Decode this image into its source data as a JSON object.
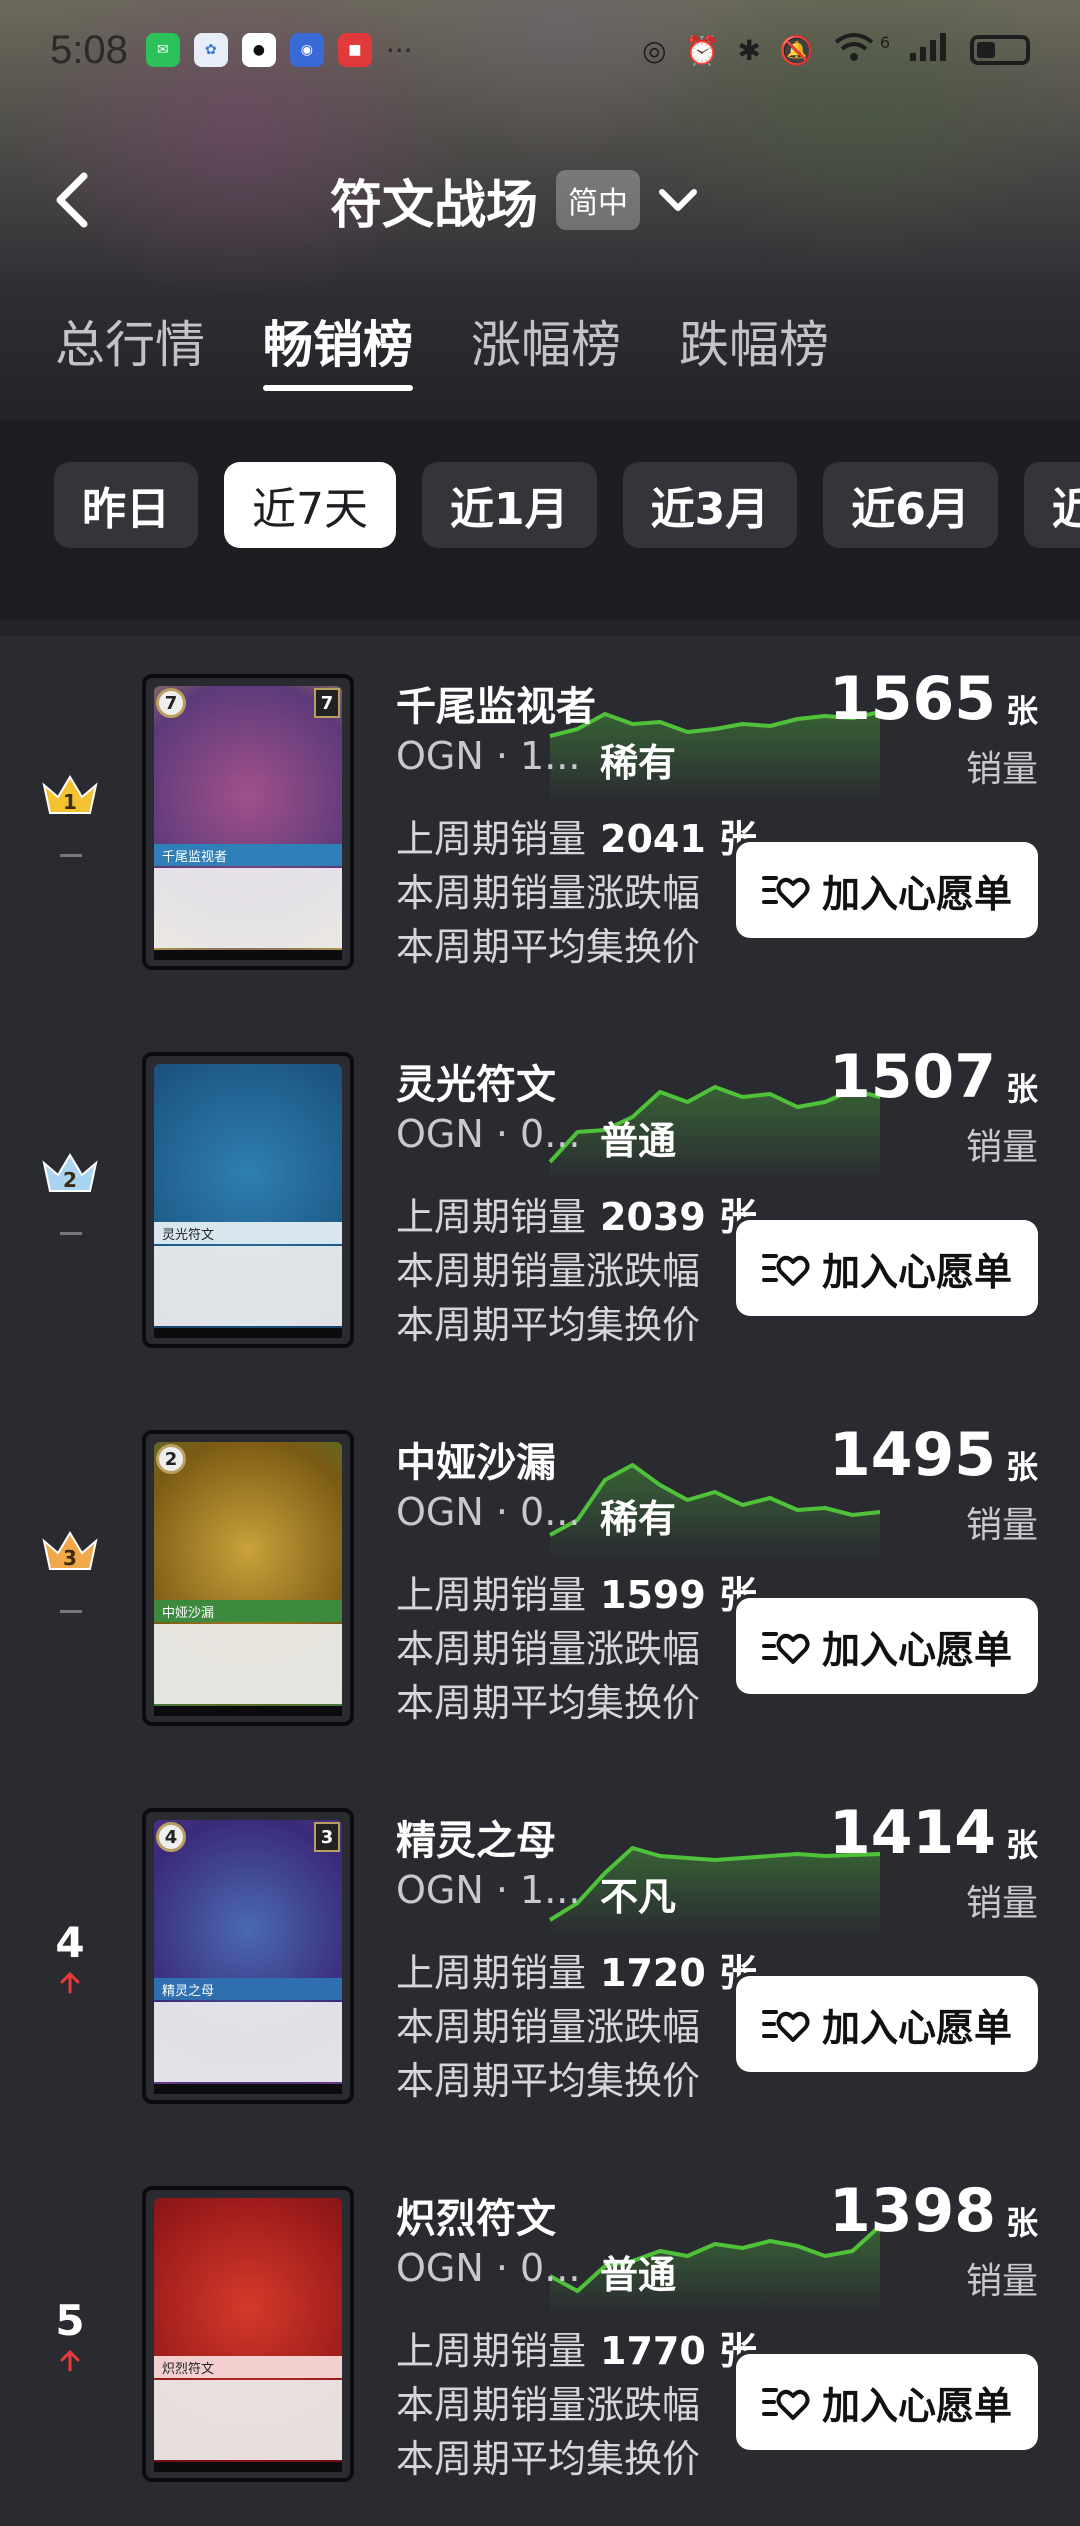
{
  "status_bar": {
    "time": "5:08",
    "signal_label": "6"
  },
  "nav": {
    "title": "符文战场",
    "lang_badge": "简中"
  },
  "tabs": [
    {
      "label": "总行情",
      "active": false
    },
    {
      "label": "畅销榜",
      "active": true
    },
    {
      "label": "涨幅榜",
      "active": false
    },
    {
      "label": "跌幅榜",
      "active": false
    }
  ],
  "periods": [
    {
      "label": "昨日",
      "active": false
    },
    {
      "label": "近7天",
      "active": true
    },
    {
      "label": "近1月",
      "active": false
    },
    {
      "label": "近3月",
      "active": false
    },
    {
      "label": "近6月",
      "active": false
    },
    {
      "label": "近",
      "active": false
    }
  ],
  "labels": {
    "sales_unit": "张",
    "sales_label": "销量",
    "prev_label": "上周期销量",
    "change_label": "本周期销量涨跌幅",
    "avg_label": "本周期平均集换价",
    "wish_button": "加入心愿单"
  },
  "cards": [
    {
      "rank": "1",
      "rank_color": "#f2c230",
      "name": "千尾监视者",
      "code": "OGN · 1...",
      "rarity": "稀有",
      "sales": "1565",
      "prev_sales": "2041 张",
      "thumb_cost": "7",
      "thumb_power": "7",
      "thumb_name": "千尾监视者",
      "art_colors": [
        "#5c3a7a",
        "#a0508a",
        "#b8a040"
      ],
      "band_color": "#2f7fb8",
      "trend": [
        0.42,
        0.35,
        0.2,
        0.3,
        0.28,
        0.38,
        0.35,
        0.3,
        0.32,
        0.25,
        0.22,
        0.24,
        0.18
      ]
    },
    {
      "rank": "2",
      "rank_color": "#a9d4f2",
      "name": "灵光符文",
      "code": "OGN · 0...",
      "rarity": "普通",
      "sales": "1507",
      "prev_sales": "2039 张",
      "thumb_cost": "",
      "thumb_power": "",
      "thumb_name": "灵光符文",
      "art_colors": [
        "#1e5a88",
        "#2e7fb0",
        "#163f66"
      ],
      "band_color": "#d8e6ee",
      "trend": [
        0.9,
        0.6,
        0.58,
        0.45,
        0.2,
        0.3,
        0.15,
        0.25,
        0.22,
        0.35,
        0.3,
        0.18,
        0.25
      ]
    },
    {
      "rank": "3",
      "rank_color": "#f0a84a",
      "name": "中娅沙漏",
      "code": "OGN · 0...",
      "rarity": "稀有",
      "sales": "1495",
      "prev_sales": "1599 张",
      "thumb_cost": "2",
      "thumb_power": "",
      "thumb_name": "中娅沙漏",
      "art_colors": [
        "#7a5a14",
        "#c9a23a",
        "#3d7a3a"
      ],
      "band_color": "#3b8a3e",
      "trend": [
        0.85,
        0.7,
        0.3,
        0.15,
        0.35,
        0.5,
        0.42,
        0.55,
        0.48,
        0.6,
        0.58,
        0.65,
        0.62
      ]
    },
    {
      "rank": "4",
      "rank_color": "#ffffff",
      "name": "精灵之母",
      "code": "OGN · 1...",
      "rarity": "不凡",
      "sales": "1414",
      "prev_sales": "1720 张",
      "thumb_cost": "4",
      "thumb_power": "3",
      "thumb_name": "精灵之母",
      "art_colors": [
        "#3a2a7a",
        "#4a6ab0",
        "#6a3a8a"
      ],
      "band_color": "#2f6fb0",
      "trend": [
        0.92,
        0.75,
        0.45,
        0.2,
        0.28,
        0.3,
        0.32,
        0.3,
        0.28,
        0.26,
        0.28,
        0.27,
        0.26
      ]
    },
    {
      "rank": "5",
      "rank_color": "#ffffff",
      "name": "炽烈符文",
      "code": "OGN · 0...",
      "rarity": "普通",
      "sales": "1398",
      "prev_sales": "1770 张",
      "thumb_cost": "",
      "thumb_power": "",
      "thumb_name": "炽烈符文",
      "art_colors": [
        "#9a1a1a",
        "#d43a2a",
        "#6a0e12"
      ],
      "band_color": "#f2d0d0",
      "trend": [
        0.7,
        0.85,
        0.6,
        0.55,
        0.45,
        0.5,
        0.38,
        0.42,
        0.35,
        0.4,
        0.5,
        0.45,
        0.2
      ]
    }
  ]
}
